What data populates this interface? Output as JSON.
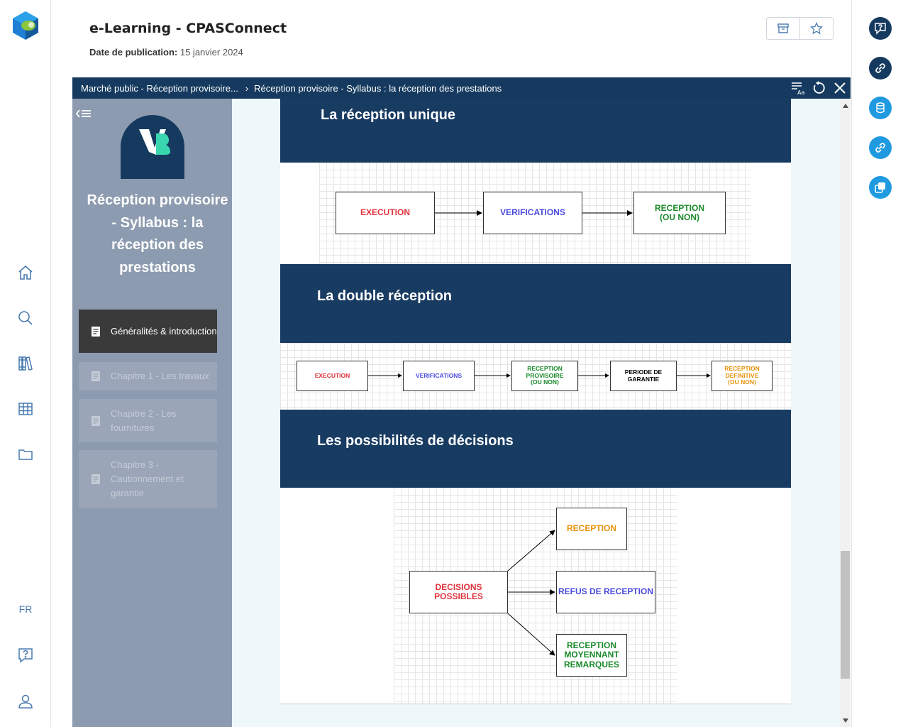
{
  "header": {
    "title": "e-Learning - CPASConnect",
    "date_label": "Date de publication:",
    "date_value": "15 janvier 2024"
  },
  "left_rail": {
    "lang": "FR",
    "icons": [
      "home-icon",
      "search-icon",
      "library-icon",
      "grid-icon",
      "folder-icon",
      "help-icon",
      "user-icon"
    ]
  },
  "right_rail": {
    "icons": [
      "feedback-icon",
      "link-icon",
      "database-icon",
      "link-alt-icon",
      "copy-icon"
    ]
  },
  "viewer": {
    "breadcrumb_1": "Marché public - Réception provisoire...",
    "breadcrumb_sep": "›",
    "breadcrumb_2": "Réception provisoire - Syllabus : la réception des prestations"
  },
  "course": {
    "title": "Réception provisoire - Syllabus : la réception des prestations",
    "chapters": [
      {
        "label": "Généralités & introduction",
        "state": "active"
      },
      {
        "label": "Chapitre 1 - Les travaux",
        "state": "locked"
      },
      {
        "label": "Chapitre 2 - Les fournitures",
        "state": "locked"
      },
      {
        "label": "Chapitre 3 - Cautionnement et garantie",
        "state": "locked"
      }
    ]
  },
  "sections": {
    "s1_title": "La réception unique",
    "s2_title": "La double réception",
    "s3_title": "Les possibilités de décisions"
  },
  "diagram1": {
    "execution": "EXECUTION",
    "verifications": "VERIFICATIONS",
    "reception_l1": "RECEPTION",
    "reception_l2": "(OU NON)"
  },
  "diagram2": {
    "execution": "EXECUTION",
    "verifications": "VERIFICATIONS",
    "prov_l1": "RECEPTION",
    "prov_l2": "PROVISOIRE",
    "prov_l3": "(OU NON)",
    "periode_l1": "PERIODE DE",
    "periode_l2": "GARANTIE",
    "def_l1": "RECEPTION",
    "def_l2": "DEFINITIVE",
    "def_l3": "(OU NON)"
  },
  "diagram3": {
    "decisions_l1": "DECISIONS",
    "decisions_l2": "POSSIBLES",
    "reception": "RECEPTION",
    "refus": "REFUS DE RECEPTION",
    "moyennant_l1": "RECEPTION",
    "moyennant_l2": "MOYENNANT",
    "moyennant_l3": "REMARQUES"
  },
  "colors": {
    "navy": "#183b62",
    "red": "#e0323c",
    "blue": "#4a4ae0",
    "green": "#1a8a2a",
    "orange": "#e8920a"
  }
}
